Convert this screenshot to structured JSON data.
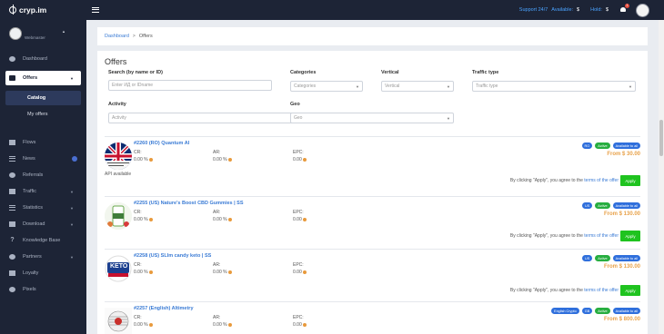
{
  "app": {
    "logo": "cryp.im"
  },
  "topbar": {
    "support": "Support 24/7",
    "available": "Available:",
    "available_currency": "$",
    "hold": "Hold:",
    "hold_currency": "$",
    "notifications": "1"
  },
  "sidebar": {
    "user_name": "Webmaster",
    "items": [
      {
        "label": "Dashboard",
        "icon": "dashboard-icon"
      },
      {
        "label": "Offers",
        "icon": "offers-icon"
      },
      {
        "label": "Catalog",
        "icon": "catalog-icon"
      },
      {
        "label": "My offers"
      },
      {
        "label": "Flows",
        "icon": "flows-icon"
      },
      {
        "label": "News",
        "icon": "news-icon"
      },
      {
        "label": "Referrals",
        "icon": "referrals-icon"
      },
      {
        "label": "Traffic",
        "icon": "traffic-icon"
      },
      {
        "label": "Statistics",
        "icon": "statistics-icon"
      },
      {
        "label": "Download",
        "icon": "download-icon"
      },
      {
        "label": "Knowledge Base",
        "icon": "question-icon"
      },
      {
        "label": "Partners",
        "icon": "partners-icon"
      },
      {
        "label": "Loyalty",
        "icon": "loyalty-icon"
      },
      {
        "label": "Pixels",
        "icon": "pixels-icon"
      }
    ]
  },
  "breadcrumb": {
    "home": "Dashboard",
    "current": "Offers"
  },
  "page": {
    "title": "Offers"
  },
  "filters": {
    "search_label": "Search (by name or ID)",
    "search_placeholder": "Enter ИД or IDname",
    "categories_label": "Categories",
    "categories_value": "Categories",
    "vertical_label": "Vertical",
    "vertical_value": "Vertical",
    "traffic_label": "Traffic type",
    "traffic_value": "Traffic type",
    "activity_label": "Activity",
    "activity_value": "Activity",
    "geo_label": "Geo",
    "geo_value": "Geo"
  },
  "offers": [
    {
      "title": "#2260 (RO) Quantum AI",
      "cr_label": "CR:",
      "cr": "0.00 %",
      "ar_label": "AR:",
      "ar": "0.00 %",
      "epc_label": "EPC:",
      "epc": "0.00",
      "api_note": "API available",
      "badges": [
        "RO",
        "Active",
        "Available to all"
      ],
      "price": "From $ 30.00",
      "agree_text": "By clicking \"Apply\", you agree to the",
      "terms": "terms of the offer",
      "apply": "Apply",
      "image": "uk-flag-icon"
    },
    {
      "title": "#2255 (US) Nature's Boost CBD Gummies | SS",
      "cr_label": "CR:",
      "cr": "0.00 %",
      "ar_label": "AR:",
      "ar": "0.00 %",
      "epc_label": "EPC:",
      "epc": "0.00",
      "badges": [
        "US",
        "Active",
        "Available to all"
      ],
      "price": "From $ 130.00",
      "agree_text": "By clicking \"Apply\", you agree to the",
      "terms": "terms of the offer",
      "apply": "Apply",
      "image": "cbd-gummies-icon"
    },
    {
      "title": "#2258 (US) SLIm candy keto | SS",
      "cr_label": "CR:",
      "cr": "0.00 %",
      "ar_label": "AR:",
      "ar": "0.00 %",
      "epc_label": "EPC:",
      "epc": "0.00",
      "badges": [
        "US",
        "Active",
        "Available to all"
      ],
      "price": "From $ 130.00",
      "agree_text": "By clicking \"Apply\", you agree to the",
      "terms": "terms of the offer",
      "apply": "Apply",
      "image": "keto-gummies-icon",
      "image_text": "KETO"
    },
    {
      "title": "#2257 (English) Altimetry",
      "cr_label": "CR:",
      "cr": "0.00 %",
      "ar_label": "AR:",
      "ar": "0.00 %",
      "epc_label": "EPC:",
      "epc": "0.00",
      "badges": [
        "English Crypto",
        "GB",
        "Active",
        "Available to all"
      ],
      "price": "From $ 800.00",
      "image": "altimetry-icon"
    }
  ],
  "colors": {
    "sidebar_bg": "#1d2436",
    "link": "#3a7bd5",
    "price": "#e8a24a",
    "apply": "#1fc31f",
    "badge_blue": "#2f6fdc",
    "badge_green": "#27ae40"
  }
}
